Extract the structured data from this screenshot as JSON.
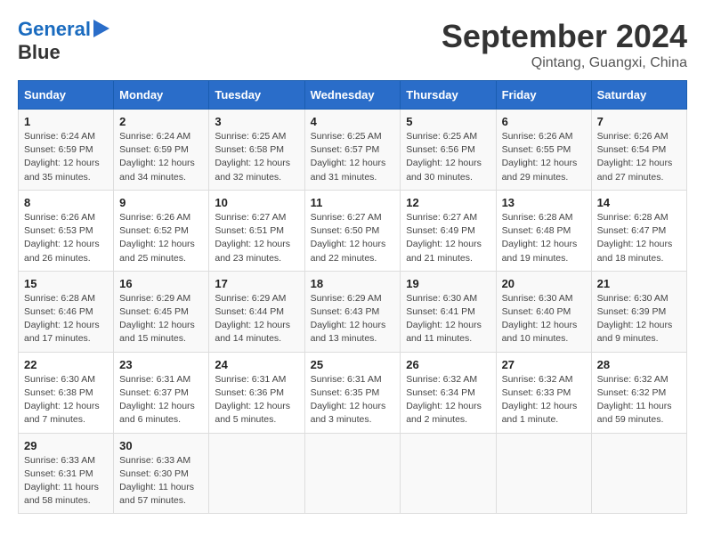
{
  "header": {
    "logo_line1": "General",
    "logo_line2": "Blue",
    "month": "September 2024",
    "location": "Qintang, Guangxi, China"
  },
  "weekdays": [
    "Sunday",
    "Monday",
    "Tuesday",
    "Wednesday",
    "Thursday",
    "Friday",
    "Saturday"
  ],
  "weeks": [
    [
      {
        "day": "1",
        "detail": "Sunrise: 6:24 AM\nSunset: 6:59 PM\nDaylight: 12 hours\nand 35 minutes."
      },
      {
        "day": "2",
        "detail": "Sunrise: 6:24 AM\nSunset: 6:59 PM\nDaylight: 12 hours\nand 34 minutes."
      },
      {
        "day": "3",
        "detail": "Sunrise: 6:25 AM\nSunset: 6:58 PM\nDaylight: 12 hours\nand 32 minutes."
      },
      {
        "day": "4",
        "detail": "Sunrise: 6:25 AM\nSunset: 6:57 PM\nDaylight: 12 hours\nand 31 minutes."
      },
      {
        "day": "5",
        "detail": "Sunrise: 6:25 AM\nSunset: 6:56 PM\nDaylight: 12 hours\nand 30 minutes."
      },
      {
        "day": "6",
        "detail": "Sunrise: 6:26 AM\nSunset: 6:55 PM\nDaylight: 12 hours\nand 29 minutes."
      },
      {
        "day": "7",
        "detail": "Sunrise: 6:26 AM\nSunset: 6:54 PM\nDaylight: 12 hours\nand 27 minutes."
      }
    ],
    [
      {
        "day": "8",
        "detail": "Sunrise: 6:26 AM\nSunset: 6:53 PM\nDaylight: 12 hours\nand 26 minutes."
      },
      {
        "day": "9",
        "detail": "Sunrise: 6:26 AM\nSunset: 6:52 PM\nDaylight: 12 hours\nand 25 minutes."
      },
      {
        "day": "10",
        "detail": "Sunrise: 6:27 AM\nSunset: 6:51 PM\nDaylight: 12 hours\nand 23 minutes."
      },
      {
        "day": "11",
        "detail": "Sunrise: 6:27 AM\nSunset: 6:50 PM\nDaylight: 12 hours\nand 22 minutes."
      },
      {
        "day": "12",
        "detail": "Sunrise: 6:27 AM\nSunset: 6:49 PM\nDaylight: 12 hours\nand 21 minutes."
      },
      {
        "day": "13",
        "detail": "Sunrise: 6:28 AM\nSunset: 6:48 PM\nDaylight: 12 hours\nand 19 minutes."
      },
      {
        "day": "14",
        "detail": "Sunrise: 6:28 AM\nSunset: 6:47 PM\nDaylight: 12 hours\nand 18 minutes."
      }
    ],
    [
      {
        "day": "15",
        "detail": "Sunrise: 6:28 AM\nSunset: 6:46 PM\nDaylight: 12 hours\nand 17 minutes."
      },
      {
        "day": "16",
        "detail": "Sunrise: 6:29 AM\nSunset: 6:45 PM\nDaylight: 12 hours\nand 15 minutes."
      },
      {
        "day": "17",
        "detail": "Sunrise: 6:29 AM\nSunset: 6:44 PM\nDaylight: 12 hours\nand 14 minutes."
      },
      {
        "day": "18",
        "detail": "Sunrise: 6:29 AM\nSunset: 6:43 PM\nDaylight: 12 hours\nand 13 minutes."
      },
      {
        "day": "19",
        "detail": "Sunrise: 6:30 AM\nSunset: 6:41 PM\nDaylight: 12 hours\nand 11 minutes."
      },
      {
        "day": "20",
        "detail": "Sunrise: 6:30 AM\nSunset: 6:40 PM\nDaylight: 12 hours\nand 10 minutes."
      },
      {
        "day": "21",
        "detail": "Sunrise: 6:30 AM\nSunset: 6:39 PM\nDaylight: 12 hours\nand 9 minutes."
      }
    ],
    [
      {
        "day": "22",
        "detail": "Sunrise: 6:30 AM\nSunset: 6:38 PM\nDaylight: 12 hours\nand 7 minutes."
      },
      {
        "day": "23",
        "detail": "Sunrise: 6:31 AM\nSunset: 6:37 PM\nDaylight: 12 hours\nand 6 minutes."
      },
      {
        "day": "24",
        "detail": "Sunrise: 6:31 AM\nSunset: 6:36 PM\nDaylight: 12 hours\nand 5 minutes."
      },
      {
        "day": "25",
        "detail": "Sunrise: 6:31 AM\nSunset: 6:35 PM\nDaylight: 12 hours\nand 3 minutes."
      },
      {
        "day": "26",
        "detail": "Sunrise: 6:32 AM\nSunset: 6:34 PM\nDaylight: 12 hours\nand 2 minutes."
      },
      {
        "day": "27",
        "detail": "Sunrise: 6:32 AM\nSunset: 6:33 PM\nDaylight: 12 hours\nand 1 minute."
      },
      {
        "day": "28",
        "detail": "Sunrise: 6:32 AM\nSunset: 6:32 PM\nDaylight: 11 hours\nand 59 minutes."
      }
    ],
    [
      {
        "day": "29",
        "detail": "Sunrise: 6:33 AM\nSunset: 6:31 PM\nDaylight: 11 hours\nand 58 minutes."
      },
      {
        "day": "30",
        "detail": "Sunrise: 6:33 AM\nSunset: 6:30 PM\nDaylight: 11 hours\nand 57 minutes."
      },
      {
        "day": "",
        "detail": ""
      },
      {
        "day": "",
        "detail": ""
      },
      {
        "day": "",
        "detail": ""
      },
      {
        "day": "",
        "detail": ""
      },
      {
        "day": "",
        "detail": ""
      }
    ]
  ]
}
